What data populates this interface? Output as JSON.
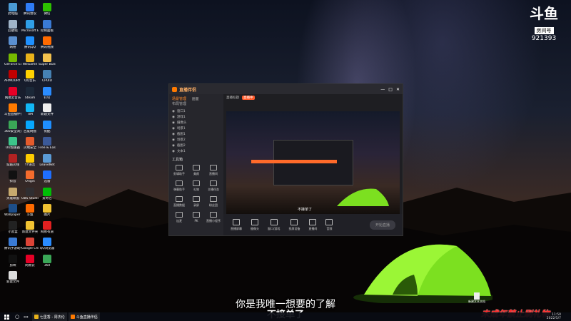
{
  "desktop_icons": [
    {
      "label": "此电脑",
      "color": "#4a9bd6"
    },
    {
      "label": "腾讯会议",
      "color": "#2f7cf6"
    },
    {
      "label": "微信",
      "color": "#2dc100"
    },
    {
      "label": "回收站",
      "color": "#a0b4c8"
    },
    {
      "label": "Microsoft Edge",
      "color": "#2f9ee6"
    },
    {
      "label": "控制面板",
      "color": "#3a7bd5"
    },
    {
      "label": "网络",
      "color": "#5a8fd0"
    },
    {
      "label": "腾讯QQ",
      "color": "#1e90ff"
    },
    {
      "label": "腾讯视频",
      "color": "#ff6a00"
    },
    {
      "label": "GeForce Experience",
      "color": "#76b900"
    },
    {
      "label": "WeGame",
      "color": "#e8b21a"
    },
    {
      "label": "Super Bunny Man",
      "color": "#f2c14e"
    },
    {
      "label": "ARMOURY CRATE",
      "color": "#c00000"
    },
    {
      "label": "QQ音乐",
      "color": "#ffd200"
    },
    {
      "label": "CPUID",
      "color": "#4682b4"
    },
    {
      "label": "网易云音乐",
      "color": "#e60026"
    },
    {
      "label": "Steam",
      "color": "#1b2838"
    },
    {
      "label": "钉钉",
      "color": "#2a8cff"
    },
    {
      "label": "斗鱼直播伴侣",
      "color": "#ff7a00"
    },
    {
      "label": "TIM",
      "color": "#12b7f5"
    },
    {
      "label": "新建文件",
      "color": "#eeeeee"
    },
    {
      "label": "360安全浏览器",
      "color": "#3aa757"
    },
    {
      "label": "百度网盘",
      "color": "#06a7ff"
    },
    {
      "label": "优酷",
      "color": "#1f8fff"
    },
    {
      "label": "UU加速器",
      "color": "#3cc48a"
    },
    {
      "label": "火绒安全",
      "color": "#e55b2c"
    },
    {
      "label": "Free & Easy",
      "color": "#3b5998"
    },
    {
      "label": "穿越火线",
      "color": "#b22222"
    },
    {
      "label": "YY语音",
      "color": "#ffcc00"
    },
    {
      "label": "LeaveNet",
      "color": "#5b9bd5"
    },
    {
      "label": "抖音",
      "color": "#111111"
    },
    {
      "label": "Origin",
      "color": "#f56c2d"
    },
    {
      "label": "迅雷",
      "color": "#1f6fff"
    },
    {
      "label": "英雄联盟",
      "color": "#c8aa6e"
    },
    {
      "label": "OBS Studio",
      "color": "#302e31"
    },
    {
      "label": "爱奇艺",
      "color": "#00be06"
    },
    {
      "label": "Wallpaper Engine",
      "color": "#1d4e89"
    },
    {
      "label": "斗鱼",
      "color": "#ff6a00"
    },
    {
      "label": "图片",
      "color": "#f1c232"
    },
    {
      "label": "小黑盒",
      "color": "#222222"
    },
    {
      "label": "新建文件夹",
      "color": "#f1c232"
    },
    {
      "label": "网易有道",
      "color": "#e02020"
    },
    {
      "label": "腾讯手游助手",
      "color": "#3a7bd5"
    },
    {
      "label": "Google Chrome",
      "color": "#db4437"
    },
    {
      "label": "QQ浏览器",
      "color": "#2a8cff"
    },
    {
      "label": "剪映",
      "color": "#111111"
    },
    {
      "label": "网易云",
      "color": "#e60026"
    },
    {
      "label": "360",
      "color": "#3aa757"
    },
    {
      "label": "新建文件",
      "color": "#dddddd"
    }
  ],
  "logo": {
    "mark": "斗鱼",
    "sub": "房间号",
    "room": "921393"
  },
  "app": {
    "title": "直播伴侣",
    "tabs": [
      "场景管理",
      "画面",
      "布局管理"
    ],
    "scenes": [
      "窗口1",
      "游戏1",
      "摄像头",
      "场景1",
      "截图1",
      "场景2",
      "截图2",
      "文本1"
    ],
    "tools_title": "工具箱",
    "tools": [
      "剪辑助手",
      "美颜",
      "直播间",
      "弹幕助手",
      "礼物",
      "主播任务",
      "直播数据",
      "录屏",
      "粉丝团",
      "连麦",
      "PK",
      "直播小程序"
    ],
    "room_title": "直播标题",
    "status": "直播中",
    "bottom_buttons": [
      "直播屏幕",
      "摄像头",
      "窗口/游戏",
      "投屏设备",
      "直播间",
      "音频"
    ],
    "start_label": "开始直播",
    "preview_subtitle": "不接单了"
  },
  "subtitle_line1": "你是我唯一想要的了解",
  "subtitle_line2": "不接单了",
  "warning": "未成年禁止刷礼物",
  "taskbar": {
    "items": [
      {
        "label": "七里香 - 周杰伦",
        "color": "#e8b21a"
      },
      {
        "label": "斗鱼直播伴侣",
        "color": "#ff7a00"
      }
    ],
    "time": "11:50",
    "date": "2022/5/7"
  },
  "desktop_file": "新建文本文档"
}
